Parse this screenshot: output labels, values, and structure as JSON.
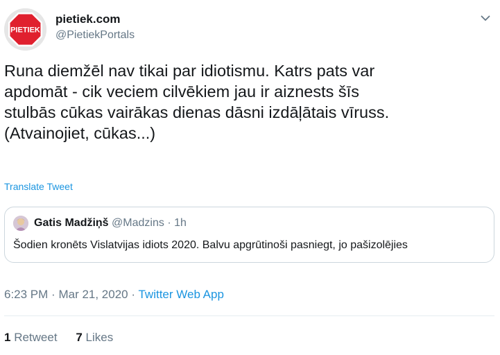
{
  "author": {
    "avatar_text": "PIETIEK",
    "display_name": "pietiek.com",
    "handle": "@PietiekPortals",
    "brand_color": "#e0202e"
  },
  "tweet": {
    "text": "Runa diemžēl nav tikai par idiotismu. Katrs pats var\napdomāt - cik veciem cilvēkiem jau ir aiznests šīs\nstulbās cūkas vairākas dienas dāsni izdāļātais vīruss.\n(Atvainojiet, cūkas...)",
    "translate_label": "Translate Tweet",
    "time": "6:23 PM",
    "separator": "·",
    "date": "Mar 21, 2020",
    "source": "Twitter Web App"
  },
  "quote": {
    "display_name": "Gatis Madžiņš",
    "handle": "@Madzins",
    "separator": "·",
    "time": "1h",
    "text": "Šodien kronēts Vislatvijas idiots 2020. Balvu apgrūtinoši pasniegt, jo pašizolējies"
  },
  "stats": {
    "retweets_count": "1",
    "retweets_label": "Retweet",
    "likes_count": "7",
    "likes_label": "Likes"
  },
  "colors": {
    "link": "#1b95e0",
    "secondary_text": "#657786",
    "border": "#ccd6dd"
  },
  "icons": {
    "menu": "chevron-down-icon"
  }
}
